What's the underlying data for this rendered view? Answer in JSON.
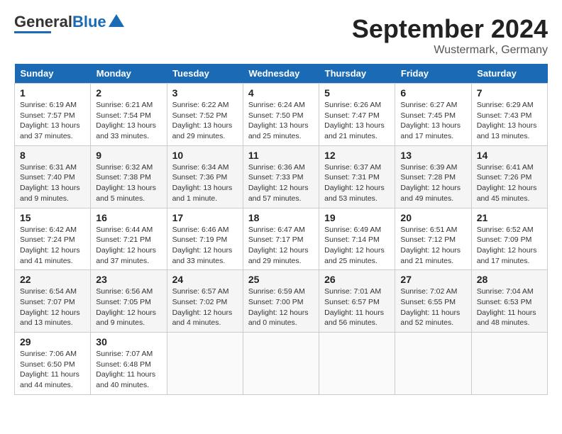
{
  "header": {
    "logo_general": "General",
    "logo_blue": "Blue",
    "month_year": "September 2024",
    "location": "Wustermark, Germany"
  },
  "days_of_week": [
    "Sunday",
    "Monday",
    "Tuesday",
    "Wednesday",
    "Thursday",
    "Friday",
    "Saturday"
  ],
  "weeks": [
    [
      {
        "day": "1",
        "sunrise": "6:19 AM",
        "sunset": "7:57 PM",
        "daylight": "13 hours and 37 minutes."
      },
      {
        "day": "2",
        "sunrise": "6:21 AM",
        "sunset": "7:54 PM",
        "daylight": "13 hours and 33 minutes."
      },
      {
        "day": "3",
        "sunrise": "6:22 AM",
        "sunset": "7:52 PM",
        "daylight": "13 hours and 29 minutes."
      },
      {
        "day": "4",
        "sunrise": "6:24 AM",
        "sunset": "7:50 PM",
        "daylight": "13 hours and 25 minutes."
      },
      {
        "day": "5",
        "sunrise": "6:26 AM",
        "sunset": "7:47 PM",
        "daylight": "13 hours and 21 minutes."
      },
      {
        "day": "6",
        "sunrise": "6:27 AM",
        "sunset": "7:45 PM",
        "daylight": "13 hours and 17 minutes."
      },
      {
        "day": "7",
        "sunrise": "6:29 AM",
        "sunset": "7:43 PM",
        "daylight": "13 hours and 13 minutes."
      }
    ],
    [
      {
        "day": "8",
        "sunrise": "6:31 AM",
        "sunset": "7:40 PM",
        "daylight": "13 hours and 9 minutes."
      },
      {
        "day": "9",
        "sunrise": "6:32 AM",
        "sunset": "7:38 PM",
        "daylight": "13 hours and 5 minutes."
      },
      {
        "day": "10",
        "sunrise": "6:34 AM",
        "sunset": "7:36 PM",
        "daylight": "13 hours and 1 minute."
      },
      {
        "day": "11",
        "sunrise": "6:36 AM",
        "sunset": "7:33 PM",
        "daylight": "12 hours and 57 minutes."
      },
      {
        "day": "12",
        "sunrise": "6:37 AM",
        "sunset": "7:31 PM",
        "daylight": "12 hours and 53 minutes."
      },
      {
        "day": "13",
        "sunrise": "6:39 AM",
        "sunset": "7:28 PM",
        "daylight": "12 hours and 49 minutes."
      },
      {
        "day": "14",
        "sunrise": "6:41 AM",
        "sunset": "7:26 PM",
        "daylight": "12 hours and 45 minutes."
      }
    ],
    [
      {
        "day": "15",
        "sunrise": "6:42 AM",
        "sunset": "7:24 PM",
        "daylight": "12 hours and 41 minutes."
      },
      {
        "day": "16",
        "sunrise": "6:44 AM",
        "sunset": "7:21 PM",
        "daylight": "12 hours and 37 minutes."
      },
      {
        "day": "17",
        "sunrise": "6:46 AM",
        "sunset": "7:19 PM",
        "daylight": "12 hours and 33 minutes."
      },
      {
        "day": "18",
        "sunrise": "6:47 AM",
        "sunset": "7:17 PM",
        "daylight": "12 hours and 29 minutes."
      },
      {
        "day": "19",
        "sunrise": "6:49 AM",
        "sunset": "7:14 PM",
        "daylight": "12 hours and 25 minutes."
      },
      {
        "day": "20",
        "sunrise": "6:51 AM",
        "sunset": "7:12 PM",
        "daylight": "12 hours and 21 minutes."
      },
      {
        "day": "21",
        "sunrise": "6:52 AM",
        "sunset": "7:09 PM",
        "daylight": "12 hours and 17 minutes."
      }
    ],
    [
      {
        "day": "22",
        "sunrise": "6:54 AM",
        "sunset": "7:07 PM",
        "daylight": "12 hours and 13 minutes."
      },
      {
        "day": "23",
        "sunrise": "6:56 AM",
        "sunset": "7:05 PM",
        "daylight": "12 hours and 9 minutes."
      },
      {
        "day": "24",
        "sunrise": "6:57 AM",
        "sunset": "7:02 PM",
        "daylight": "12 hours and 4 minutes."
      },
      {
        "day": "25",
        "sunrise": "6:59 AM",
        "sunset": "7:00 PM",
        "daylight": "12 hours and 0 minutes."
      },
      {
        "day": "26",
        "sunrise": "7:01 AM",
        "sunset": "6:57 PM",
        "daylight": "11 hours and 56 minutes."
      },
      {
        "day": "27",
        "sunrise": "7:02 AM",
        "sunset": "6:55 PM",
        "daylight": "11 hours and 52 minutes."
      },
      {
        "day": "28",
        "sunrise": "7:04 AM",
        "sunset": "6:53 PM",
        "daylight": "11 hours and 48 minutes."
      }
    ],
    [
      {
        "day": "29",
        "sunrise": "7:06 AM",
        "sunset": "6:50 PM",
        "daylight": "11 hours and 44 minutes."
      },
      {
        "day": "30",
        "sunrise": "7:07 AM",
        "sunset": "6:48 PM",
        "daylight": "11 hours and 40 minutes."
      },
      null,
      null,
      null,
      null,
      null
    ]
  ]
}
